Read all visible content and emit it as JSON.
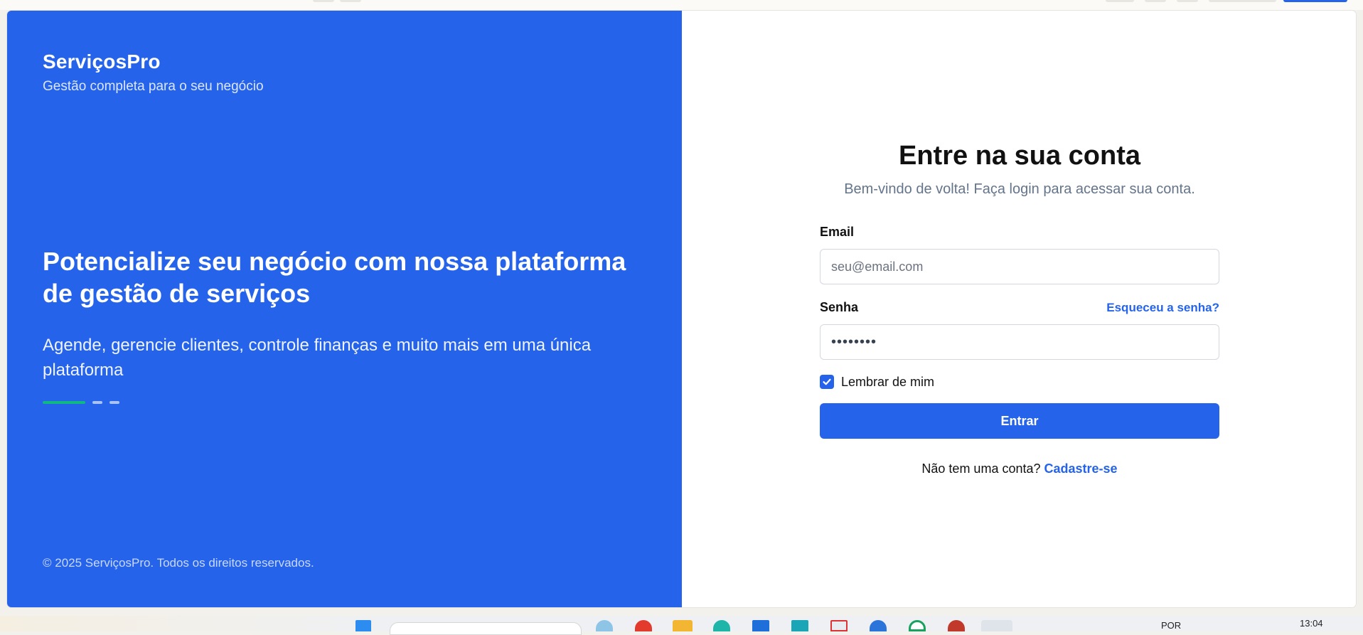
{
  "brand": {
    "name": "ServiçosPro",
    "tagline": "Gestão completa para o seu negócio"
  },
  "hero": {
    "title": "Potencialize seu negócio com nossa plataforma de gestão de serviços",
    "subtitle": "Agende, gerencie clientes, controle finanças e muito mais em uma única plataforma",
    "carousel": {
      "slides": 3,
      "active_index": 0
    }
  },
  "footer": {
    "copyright": "© 2025 ServiçosPro. Todos os direitos reservados."
  },
  "login": {
    "title": "Entre na sua conta",
    "subtitle": "Bem-vindo de volta! Faça login para acessar sua conta.",
    "email_label": "Email",
    "email_placeholder": "seu@email.com",
    "password_label": "Senha",
    "forgot_link": "Esqueceu a senha?",
    "password_mask": "••••••••",
    "remember_label": "Lembrar de mim",
    "remember_checked": true,
    "submit_label": "Entrar",
    "signup_prompt": "Não tem uma conta?",
    "signup_link": "Cadastre-se"
  },
  "taskbar": {
    "language": "POR",
    "time": "13:04"
  },
  "colors": {
    "primary": "#2563eb",
    "carousel_active": "#10b981"
  }
}
